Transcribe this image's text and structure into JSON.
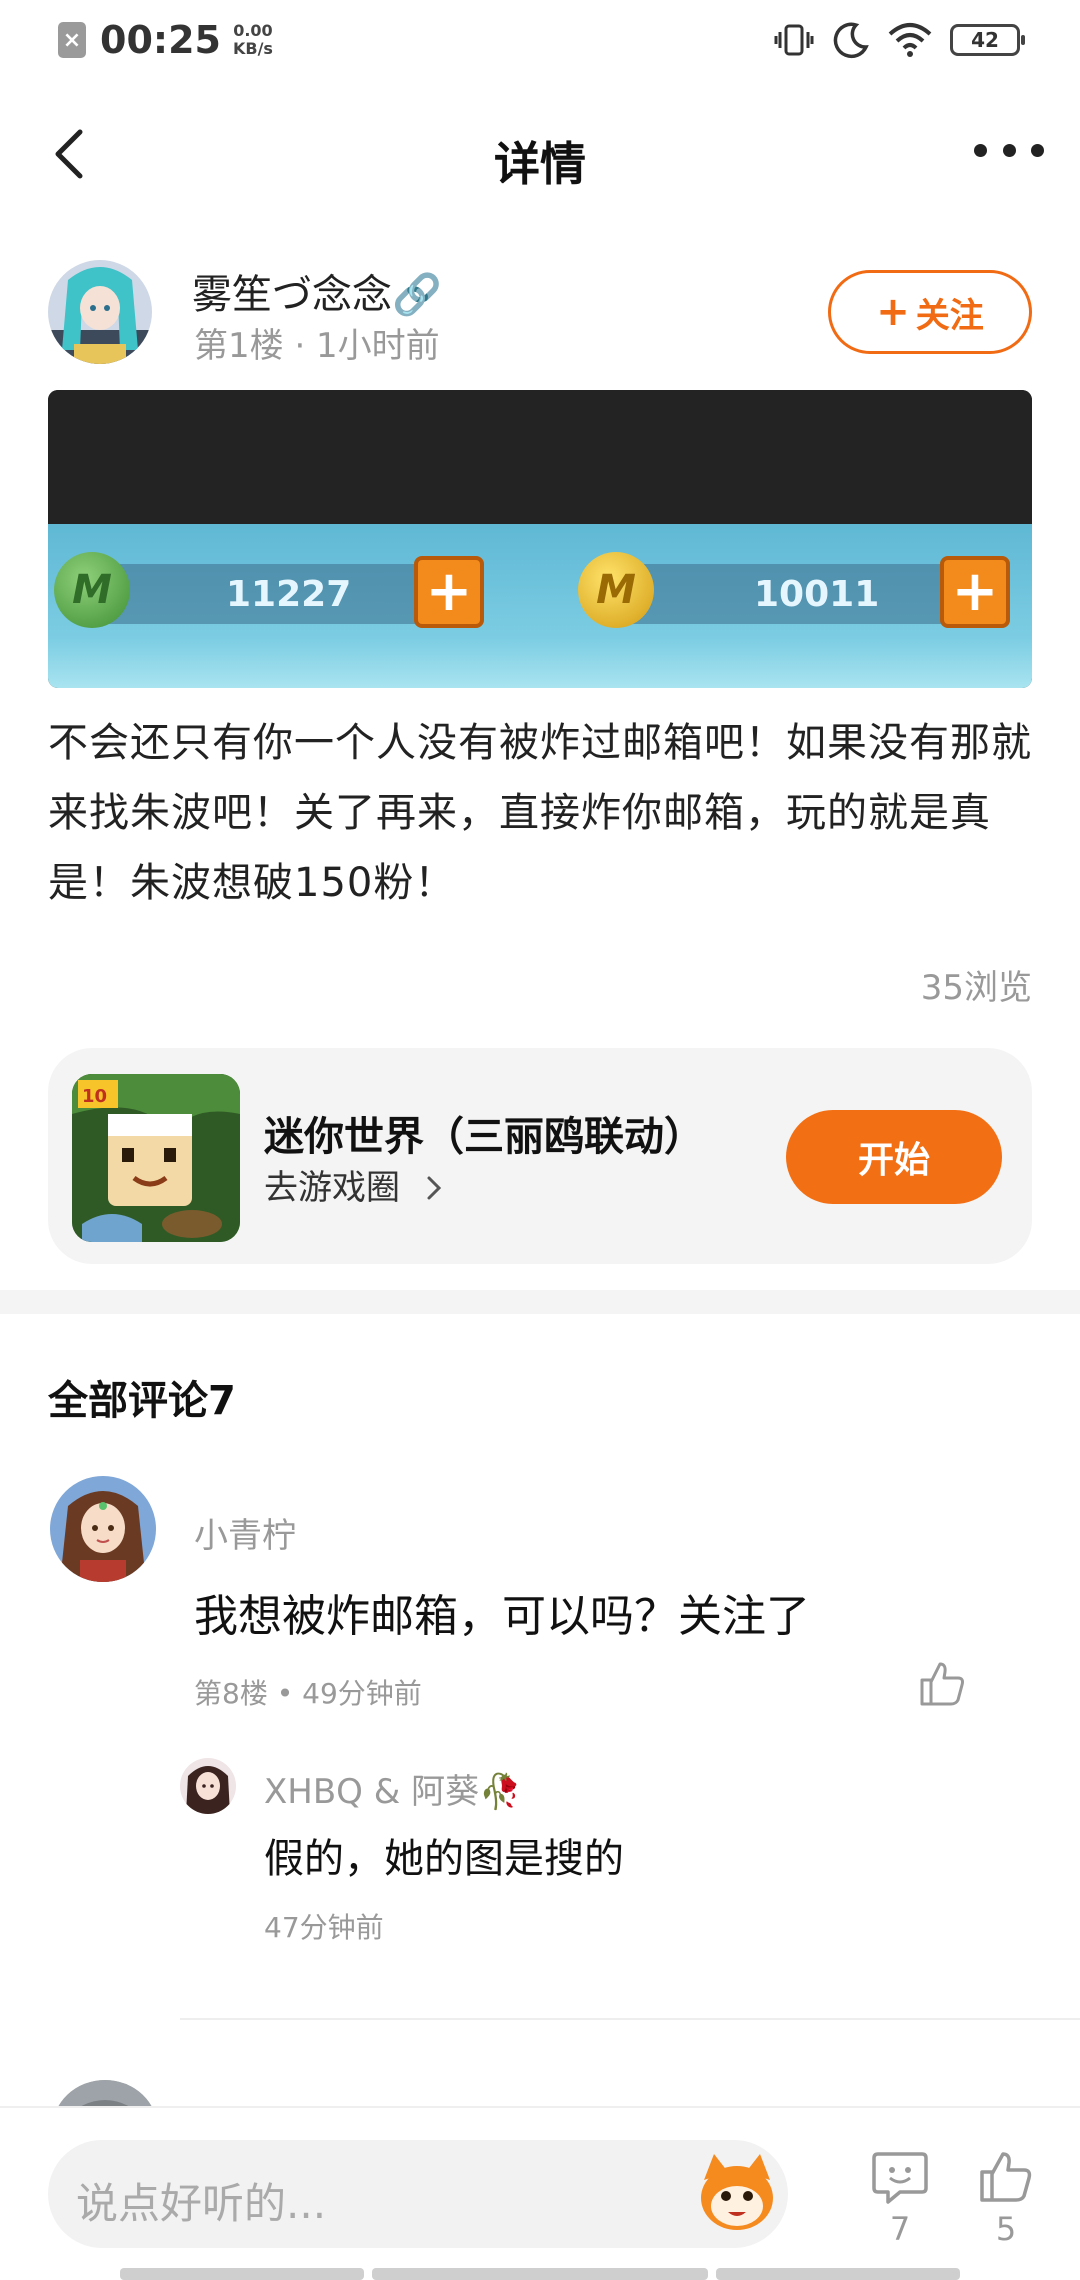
{
  "status_bar": {
    "sim_icon": "no-sim-icon",
    "time": "00:25",
    "speed_value": "0.00",
    "speed_unit": "KB/s",
    "battery": "42"
  },
  "header": {
    "title": "详情"
  },
  "author": {
    "name": "雾笙づ念念🔗",
    "meta": "第1楼 · 1小时前",
    "follow_label": "关注"
  },
  "post_image": {
    "resource1_value": "11227",
    "resource2_value": "10011",
    "coin_letter": "M"
  },
  "post": {
    "text": "不会还只有你一个人没有被炸过邮箱吧！如果没有那就来找朱波吧！关了再来，直接炸你邮箱，玩的就是真是！朱波想破150粉！",
    "views": "35浏览"
  },
  "game_card": {
    "name": "迷你世界（三丽鸥联动）",
    "link_label": "去游戏圈",
    "start_label": "开始"
  },
  "comments": {
    "title": "全部评论7",
    "items": [
      {
        "author": "小青柠",
        "text": "我想被炸邮箱，可以吗？关注了",
        "meta": "第8楼 • 49分钟前",
        "replies": [
          {
            "author": "XHBQ & 阿葵🥀",
            "text": "假的，她的图是搜的",
            "time": "47分钟前"
          }
        ]
      }
    ]
  },
  "bottom_bar": {
    "input_placeholder": "说点好听的...",
    "comment_count": "7",
    "like_count": "5"
  },
  "colors": {
    "accent": "#f36f14",
    "muted_text": "#999999",
    "card_bg": "#f4f4f4"
  }
}
